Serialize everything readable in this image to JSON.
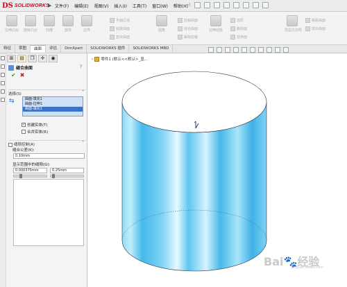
{
  "app": {
    "logo_mark": "DS",
    "logo_text": "SOLIDWORKS",
    "menu": [
      "文件(F)",
      "编辑(E)",
      "视图(V)",
      "插入(I)",
      "工具(T)",
      "窗口(W)",
      "帮助(H)"
    ]
  },
  "command_manager": {
    "buttons": [
      "拉伸凸台",
      "旋转凸台",
      "扫描",
      "放样",
      "边界",
      "拉伸切除",
      "异型孔向导"
    ],
    "rows": [
      [
        "平面区域",
        "圆角",
        "剪裁曲面",
        "加厚"
      ],
      [
        "延展曲面",
        "等距曲面",
        "缝合曲面",
        "删除面"
      ],
      [
        "直纹曲面",
        "填充曲面",
        "解除剪裁",
        "替换面"
      ]
    ]
  },
  "tabs": {
    "items": [
      "特征",
      "草图",
      "曲面",
      "评估",
      "DimXpert",
      "SOLIDWORKS 插件",
      "SOLIDWORKS MBD"
    ],
    "active": "曲面"
  },
  "property_manager": {
    "title": "缝合曲面",
    "help": "?",
    "ok": "✔",
    "cancel": "✖",
    "selection": {
      "header": "选择(S)",
      "items": [
        "曲面-填充1",
        "曲面-拉伸1",
        "曲面-填充1"
      ],
      "selected_index": 2,
      "create_solid": {
        "label": "创建实体(T)",
        "checked": true
      },
      "merge_entities": {
        "label": "合并实体(R)",
        "checked": false
      }
    },
    "gap_control": {
      "header": "缝隙控制(A)",
      "checked": false,
      "tolerance_label": "缝合公差(K):",
      "tolerance_value": "0.10mm",
      "range_label": "显示范围中的缝隙(G):",
      "range_min": "0.000375mm",
      "range_max": "0.25mm"
    }
  },
  "graphics": {
    "breadcrumb": "零件1 (默认<<默认>_显..."
  },
  "watermark": {
    "text": "Bai",
    "paw": "🐾",
    "text2": "经验",
    "sub": "jingyan.baidu.com"
  },
  "colors": {
    "brand": "#d0021b",
    "cylinder_fill": "#5cc8f2",
    "selection_highlight": "#3a72c8"
  }
}
